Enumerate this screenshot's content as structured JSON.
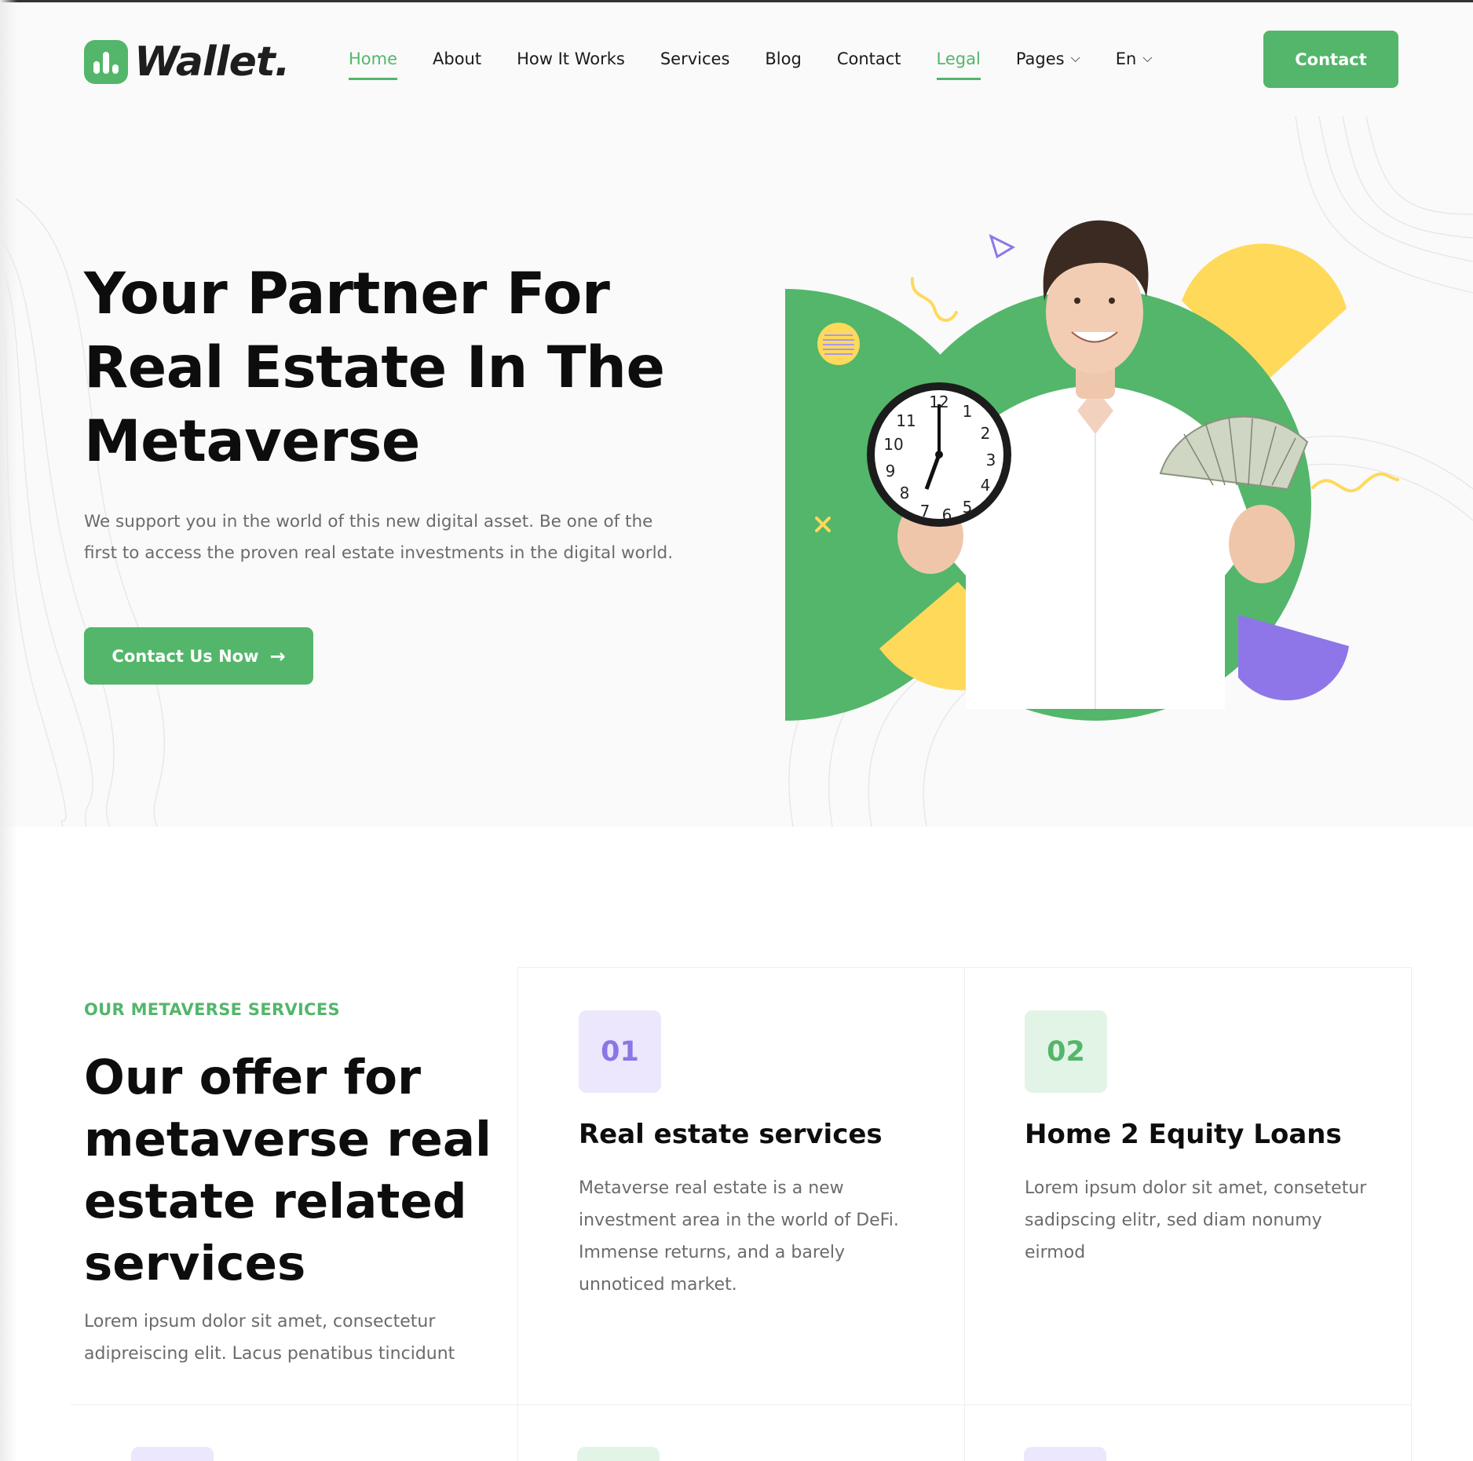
{
  "brand": {
    "name": "Wallet.",
    "color": "#53b66a"
  },
  "nav": {
    "items": [
      {
        "label": "Home",
        "active": true
      },
      {
        "label": "About"
      },
      {
        "label": "How It Works"
      },
      {
        "label": "Services"
      },
      {
        "label": "Blog"
      },
      {
        "label": "Contact"
      },
      {
        "label": "Legal",
        "active": true
      },
      {
        "label": "Pages",
        "has_dropdown": true
      },
      {
        "label": "En",
        "has_dropdown": true
      }
    ],
    "cta_label": "Contact"
  },
  "hero": {
    "title": "Your Partner For Real Estate In The Metaverse",
    "description": "We support you in the world of this new digital asset. Be one of the first to access the proven real estate investments in the digital world.",
    "button_label": "Contact Us Now",
    "button_icon": "arrow-right-icon"
  },
  "services": {
    "eyebrow": "OUR METAVERSE SERVICES",
    "title": "Our offer for metaverse real estate related services",
    "description": "Lorem ipsum dolor sit amet, consectetur adipreiscing elit. Lacus penatibus tincidunt",
    "cards": [
      {
        "number": "01",
        "title": "Real estate services",
        "description": "Metaverse real estate is a new investment area in the world of DeFi. Immense returns, and a barely unnoticed market.",
        "badge_bg": "#ece7fd",
        "badge_color": "#8a76e6"
      },
      {
        "number": "02",
        "title": "Home 2 Equity Loans",
        "description": "Lorem ipsum dolor sit amet, consetetur sadipscing elitr, sed diam nonumy eirmod",
        "badge_bg": "#e2f4e6",
        "badge_color": "#53b66a"
      }
    ]
  },
  "colors": {
    "accent": "#53b66a",
    "yellow": "#ffd95a",
    "purple": "#8f76e8",
    "text": "#0d0d0d",
    "muted": "#6b6b6b"
  }
}
